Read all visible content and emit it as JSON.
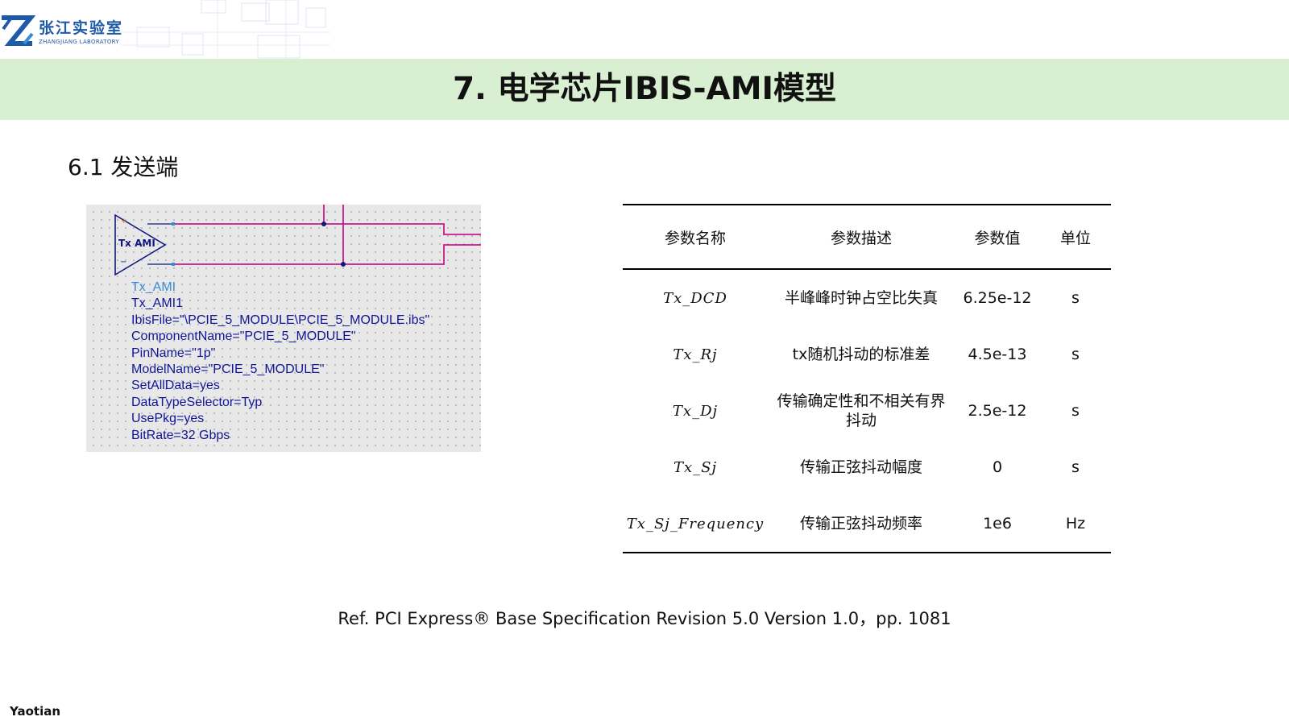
{
  "header": {
    "logo_cn": "张江实验室",
    "logo_en": "ZHANGJIANG LABORATORY",
    "title": "7. 电学芯片IBIS-AMI模型",
    "brand_color": "#1e5aa8",
    "band_color": "#d9efd2"
  },
  "section": {
    "heading": "6.1 发送端"
  },
  "schematic": {
    "amp_label": "Tx AMI",
    "plus_sign": "+",
    "minus_sign": "−",
    "wire_color": "#c8198c",
    "properties": [
      "Tx_AMI",
      "Tx_AMI1",
      "IbisFile=\"\\PCIE_5_MODULE\\PCIE_5_MODULE.ibs\"",
      "ComponentName=\"PCIE_5_MODULE\"",
      "PinName=\"1p\"",
      "ModelName=\"PCIE_5_MODULE\"",
      "SetAllData=yes",
      "DataTypeSelector=Typ",
      "UsePkg=yes",
      "BitRate=32 Gbps"
    ]
  },
  "param_table": {
    "headers": [
      "参数名称",
      "参数描述",
      "参数值",
      "单位"
    ],
    "rows": [
      {
        "name": "Tx_DCD",
        "desc": "半峰峰时钟占空比失真",
        "value": "6.25e-12",
        "unit": "s"
      },
      {
        "name": "Tx_Rj",
        "desc": "tx随机抖动的标准差",
        "value": "4.5e-13",
        "unit": "s"
      },
      {
        "name": "Tx_Dj",
        "desc": "传输确定性和不相关有界抖动",
        "value": "2.5e-12",
        "unit": "s"
      },
      {
        "name": "Tx_Sj",
        "desc": "传输正弦抖动幅度",
        "value": "0",
        "unit": "s"
      },
      {
        "name": "Tx_Sj_Frequency",
        "desc": "传输正弦抖动频率",
        "value": "1e6",
        "unit": "Hz"
      }
    ]
  },
  "reference": "Ref.  PCI Express® Base Specification Revision 5.0 Version 1.0，pp. 1081",
  "footer": {
    "author": "Yaotian"
  }
}
